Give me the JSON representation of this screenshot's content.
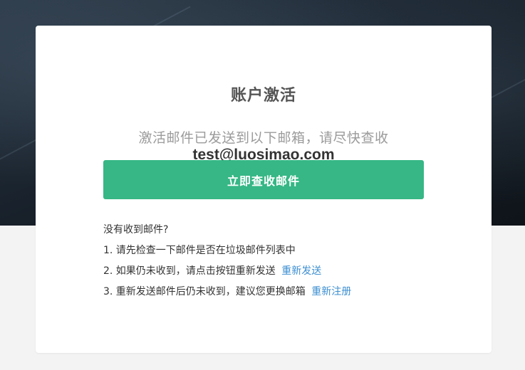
{
  "card": {
    "title": "账户激活",
    "subtitle": "激活邮件已发送到以下邮箱，请尽快查收",
    "email": "test@luosimao.com",
    "check_button_label": "立即查收邮件"
  },
  "help": {
    "heading": "没有收到邮件?",
    "items": [
      {
        "text": "1. 请先检查一下邮件是否在垃圾邮件列表中"
      },
      {
        "text": "2. 如果仍未收到，请点击按钮重新发送",
        "link": "重新发送"
      },
      {
        "text": "3. 重新发送邮件后仍未收到，建议您更换邮箱",
        "link": "重新注册"
      }
    ]
  },
  "colors": {
    "accent_green": "#36b785",
    "link_blue": "#3d8fd1",
    "page_bg": "#f3f3f3",
    "hero_bg": "#1c2631"
  }
}
